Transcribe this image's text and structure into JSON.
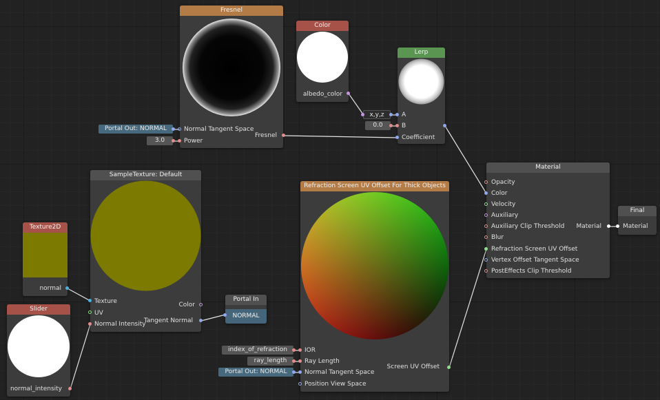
{
  "nodes": {
    "fresnel": {
      "title": "Fresnel",
      "inputs": {
        "normal_tangent_space": "Normal Tangent Space",
        "power": "Power"
      },
      "output": "Fresnel",
      "chips": {
        "portal_out": "Portal Out: NORMAL",
        "power_value": "3.0"
      }
    },
    "color": {
      "title": "Color",
      "output": "albedo_color"
    },
    "lerp": {
      "title": "Lerp",
      "inputs": {
        "a": "A",
        "b": "B",
        "coefficient": "Coefficient"
      },
      "chips": {
        "a_swizzle": "x,y,z",
        "b_value": "0.0"
      }
    },
    "material": {
      "title": "Material",
      "inputs": [
        "Opacity",
        "Color",
        "Velocity",
        "Auxiliary",
        "Auxiliary Clip Threshold",
        "Blur",
        "Refraction Screen UV Offset",
        "Vertex Offset Tangent Space",
        "PostEffects Clip Threshold"
      ],
      "output": "Material"
    },
    "final": {
      "title": "Final",
      "input": "Material"
    },
    "sample_texture": {
      "title": "SampleTexture: Default",
      "inputs": {
        "texture": "Texture",
        "uv": "UV",
        "normal_intensity": "Normal Intensity"
      },
      "outputs": {
        "color": "Color",
        "tangent_normal": "Tangent Normal"
      }
    },
    "texture2d": {
      "title": "Texture2D",
      "output": "normal"
    },
    "slider": {
      "title": "Slider",
      "output": "normal_intensity"
    },
    "portal_in": {
      "title": "Portal In",
      "value": "NORMAL"
    },
    "refraction": {
      "title": "Refraction Screen UV Offset For Thick Objects",
      "inputs": {
        "ior": "IOR",
        "ray_length": "Ray Length",
        "normal_tangent_space": "Normal Tangent Space",
        "position_view_space": "Position View Space"
      },
      "output": "Screen UV Offset",
      "chips": {
        "ior": "index_of_refraction",
        "ray_length": "ray_length",
        "portal_out": "Portal Out: NORMAL"
      }
    }
  },
  "colors": {
    "canvas": "#222222",
    "node_body": "#3c3c3c",
    "header_orange": "#b37c47",
    "header_red": "#a65249",
    "header_green": "#5a9652",
    "header_gray": "#505050",
    "pin_blue": "#8fa8ee",
    "pin_pink": "#e58b8b",
    "pin_purple": "#c494e0",
    "pin_green": "#8ee08e",
    "pin_cyan": "#4cb0e0",
    "texture_olive": "#7d7a00"
  }
}
